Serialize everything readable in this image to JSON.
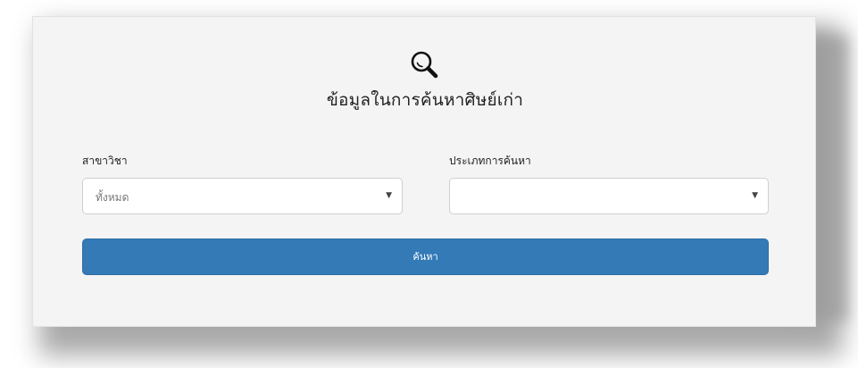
{
  "form": {
    "title": "ข้อมูลในการค้นหาศิษย์เก่า",
    "search_icon": "search-icon",
    "major": {
      "label": "สาขาวิชา",
      "selected": "ทั้งหมด"
    },
    "search_type": {
      "label": "ประเภทการค้นหา",
      "selected": ""
    },
    "submit_label": "ค้นหา"
  },
  "colors": {
    "panel_bg": "#f4f4f4",
    "button_bg": "#337ab7",
    "button_text": "#ffffff"
  }
}
